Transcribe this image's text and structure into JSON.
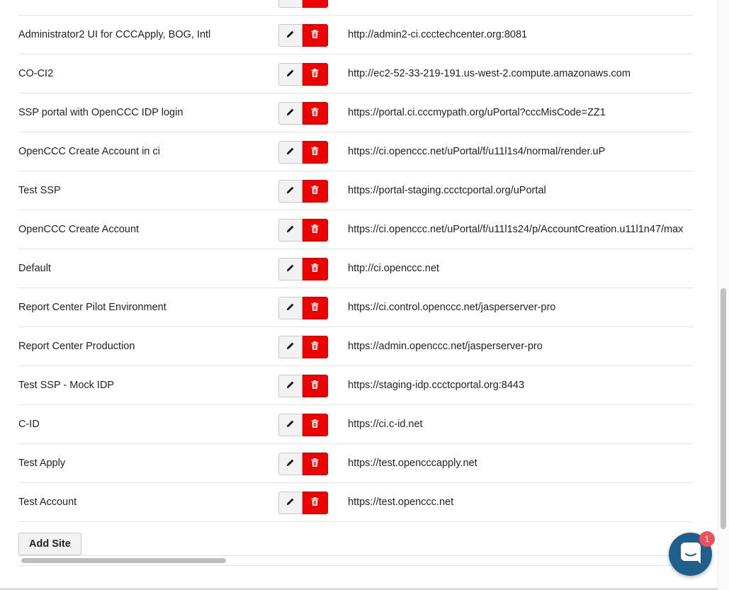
{
  "sites": [
    {
      "name": "",
      "url": ""
    },
    {
      "name": "Administrator2 UI for CCCApply, BOG, Intl",
      "url": "http://admin2-ci.ccctechcenter.org:8081"
    },
    {
      "name": "CO-CI2",
      "url": "http://ec2-52-33-219-191.us-west-2.compute.amazonaws.com"
    },
    {
      "name": "SSP portal with OpenCCC IDP login",
      "url": "https://portal.ci.cccmypath.org/uPortal?cccMisCode=ZZ1"
    },
    {
      "name": "OpenCCC Create Account in ci",
      "url": "https://ci.openccc.net/uPortal/f/u11l1s4/normal/render.uP"
    },
    {
      "name": "Test SSP",
      "url": "https://portal-staging.ccctcportal.org/uPortal"
    },
    {
      "name": "OpenCCC Create Account",
      "url": "https://ci.openccc.net/uPortal/f/u11l1s24/p/AccountCreation.u11l1n47/max"
    },
    {
      "name": "Default",
      "url": "http://ci.openccc.net"
    },
    {
      "name": "Report Center Pilot Environment",
      "url": "https://ci.control.openccc.net/jasperserver-pro"
    },
    {
      "name": "Report Center Production",
      "url": "https://admin.openccc.net/jasperserver-pro"
    },
    {
      "name": "Test SSP - Mock IDP",
      "url": "https://staging-idp.ccctcportal.org:8443"
    },
    {
      "name": "C-ID",
      "url": "https://ci.c-id.net"
    },
    {
      "name": "Test Apply",
      "url": "https://test.opencccapply.net"
    },
    {
      "name": "Test Account",
      "url": "https://test.openccc.net"
    }
  ],
  "add_site_label": "Add Site",
  "chat": {
    "badge": "1"
  },
  "icons": {
    "edit": "pencil-icon",
    "delete": "trash-icon",
    "chat": "chat-icon"
  },
  "colors": {
    "delete_bg": "#ee0000",
    "chat_bg": "#1f5f8b",
    "badge_bg": "#f0505a"
  }
}
